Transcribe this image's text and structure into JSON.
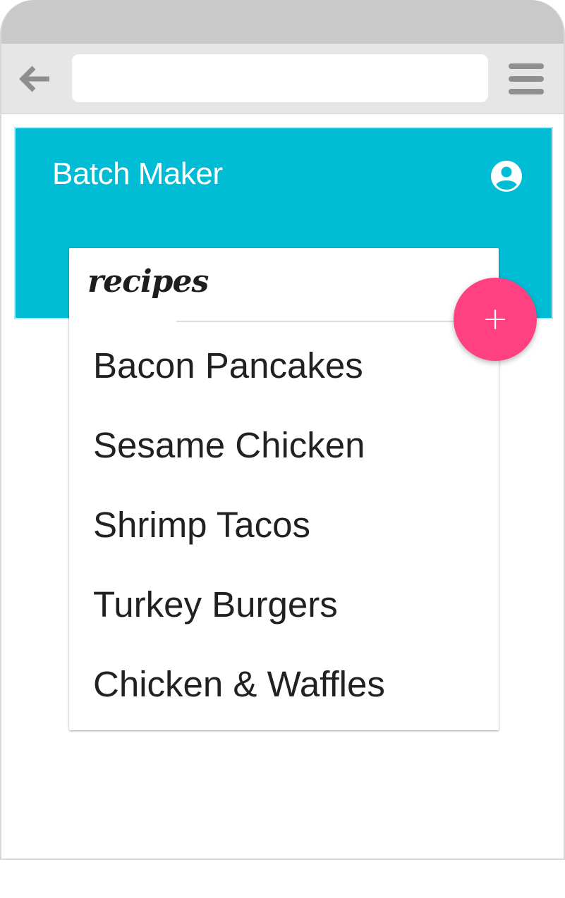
{
  "browser": {
    "back_icon": "arrow-left-icon",
    "url_value": "",
    "menu_icon": "hamburger-menu-icon"
  },
  "app": {
    "title": "Batch Maker",
    "account_icon": "account-circle-icon",
    "accent_color": "#00bcd4",
    "fab_color": "#ff4081"
  },
  "card": {
    "title": "recipes",
    "recipes": [
      "Bacon Pancakes",
      "Sesame Chicken",
      "Shrimp Tacos",
      "Turkey Burgers",
      "Chicken & Waffles"
    ]
  },
  "fab": {
    "label": "+",
    "icon": "add-icon"
  }
}
